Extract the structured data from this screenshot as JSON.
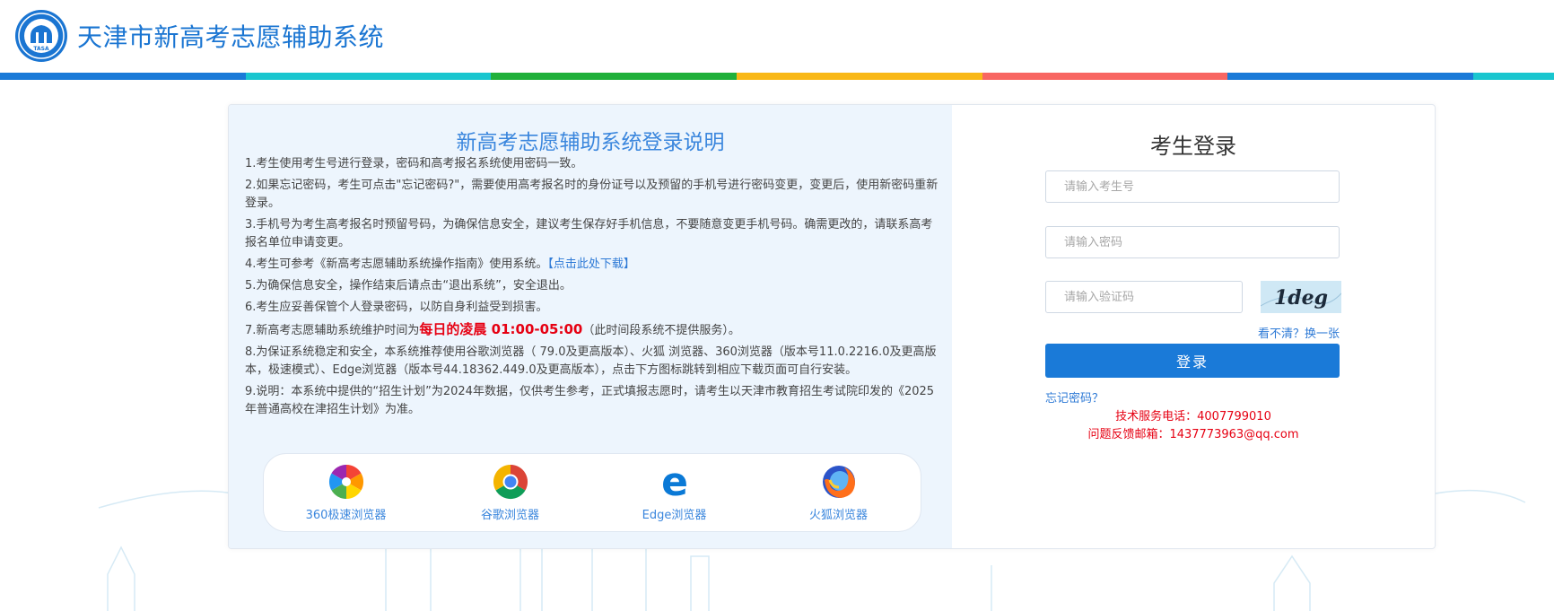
{
  "header": {
    "title": "天津市新高考志愿辅助系统",
    "logo_text": "TASA",
    "colorbar": [
      "#1a7ad8",
      "#19c6cf",
      "#20b03a",
      "#f9b817",
      "#f86662",
      "#1a7ad8",
      "#19c6cf"
    ]
  },
  "info": {
    "title": "新高考志愿辅助系统登录说明",
    "notes": [
      "1.考生使用考生号进行登录，密码和高考报名系统使用密码一致。",
      "2.如果忘记密码，考生可点击\"忘记密码?\"，需要使用高考报名时的身份证号以及预留的手机号进行密码变更，变更后，使用新密码重新登录。",
      "3.手机号为考生高考报名时预留号码，为确保信息安全，建议考生保存好手机信息，不要随意变更手机号码。确需更改的，请联系高考报名单位申请变更。",
      "4.考生可参考《新高考志愿辅助系统操作指南》使用系统。",
      "5.为确保信息安全，操作结束后请点击“退出系统”，安全退出。",
      "6.考生应妥善保管个人登录密码，以防自身利益受到损害。",
      "7.新高考志愿辅助系统维护时间为",
      "8.为保证系统稳定和安全，本系统推荐使用谷歌浏览器（ 79.0及更高版本）、火狐 浏览器、360浏览器（版本号11.0.2216.0及更高版本，极速模式）、Edge浏览器（版本号44.18362.449.0及更高版本），点击下方图标跳转到相应下载页面可自行安装。",
      "9.说明：本系统中提供的“招生计划”为2024年数据，仅供考生参考，正式填报志愿时，请考生以天津市教育招生考试院印发的《2025年普通高校在津招生计划》为准。"
    ],
    "download_link": "【点击此处下载】",
    "maintenance_time": "每日的凌晨 01:00-05:00",
    "maintenance_suffix": "（此时间段系统不提供服务）。",
    "browsers": {
      "b360": "360极速浏览器",
      "chrome": "谷歌浏览器",
      "edge": "Edge浏览器",
      "firefox": "火狐浏览器"
    }
  },
  "login": {
    "title": "考生登录",
    "username_placeholder": "请输入考生号",
    "password_placeholder": "请输入密码",
    "captcha_placeholder": "请输入验证码",
    "captcha_text": "1deg",
    "refresh_label": "看不清？换一张",
    "submit_label": "登录",
    "forgot_label": "忘记密码？",
    "phone_line": "技术服务电话：4007799010",
    "email_line": "问题反馈邮箱：1437773963@qq.com"
  }
}
